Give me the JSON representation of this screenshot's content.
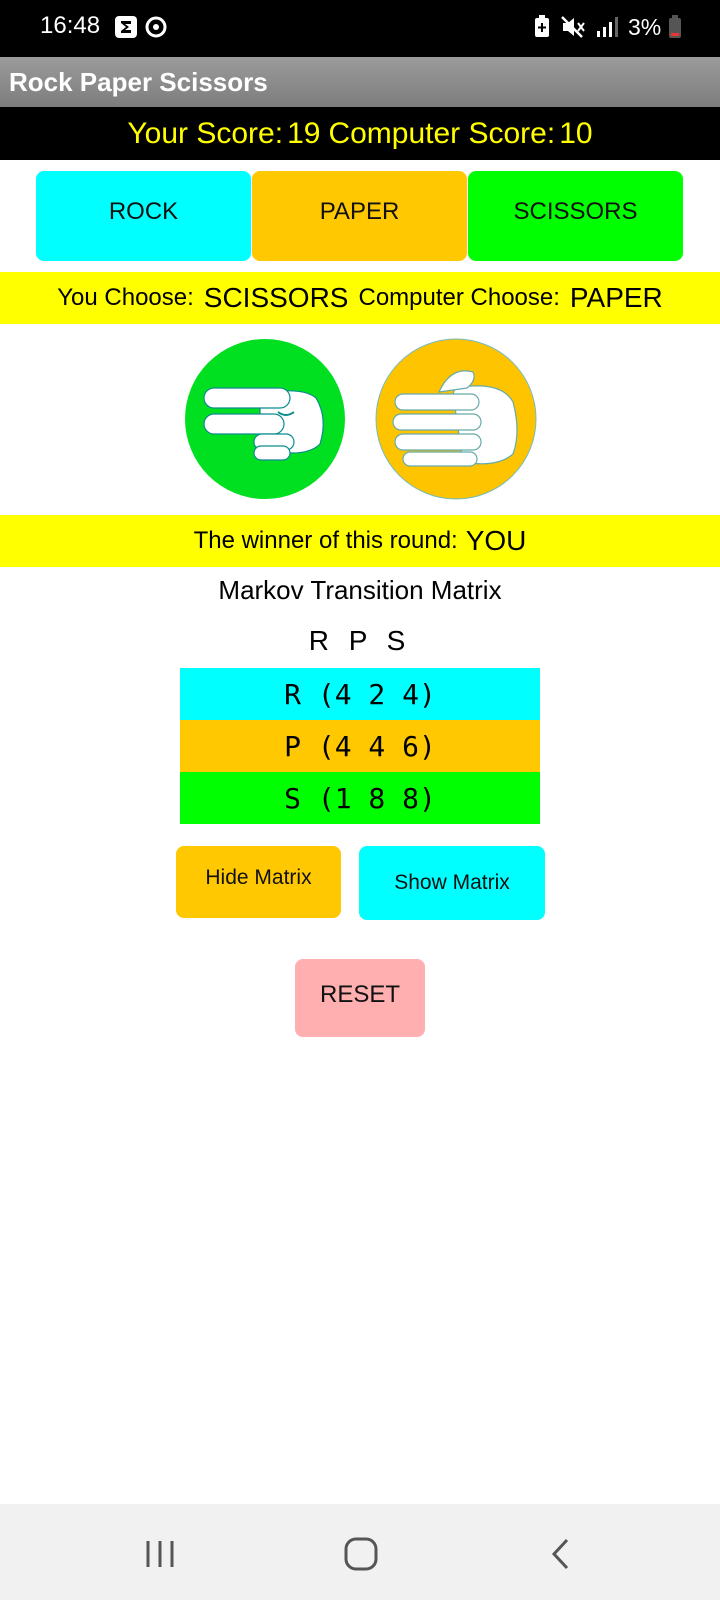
{
  "status_bar": {
    "time": "16:48",
    "battery": "3%",
    "icons": [
      "sigma-notification-icon",
      "sync-notification-icon",
      "battery-saver-icon",
      "mute-icon",
      "signal-icon",
      "battery-icon"
    ]
  },
  "app": {
    "title": "Rock Paper Scissors"
  },
  "score": {
    "player_label": "Your Score:",
    "player_value": "19",
    "computer_label": "Computer Score:",
    "computer_value": "10"
  },
  "choices": {
    "rock": "ROCK",
    "paper": "PAPER",
    "scissors": "SCISSORS"
  },
  "round": {
    "you_label": "You Choose:",
    "you_value": "SCISSORS",
    "computer_label": "Computer Choose:",
    "computer_value": "PAPER",
    "winner_label": "The winner of this round:",
    "winner_value": "YOU",
    "player_hand_icon": "scissors-hand-icon",
    "computer_hand_icon": "paper-hand-icon"
  },
  "matrix": {
    "title": "Markov Transition Matrix",
    "header": "R P S",
    "rows": [
      {
        "text": "R (4 2 4)"
      },
      {
        "text": "P (4 4 6)"
      },
      {
        "text": "S (1 8 8)"
      }
    ],
    "hide_label": "Hide Matrix",
    "show_label": "Show Matrix"
  },
  "reset_label": "RESET",
  "colors": {
    "rock": "#00ffff",
    "paper": "#ffc800",
    "scissors": "#00ff00",
    "highlight": "#ffff00",
    "reset": "#ffafaf",
    "scissors_hand_bg": "#00e020",
    "paper_hand_bg": "#ffc400"
  },
  "nav": [
    "recent-apps-icon",
    "home-icon",
    "back-icon"
  ]
}
